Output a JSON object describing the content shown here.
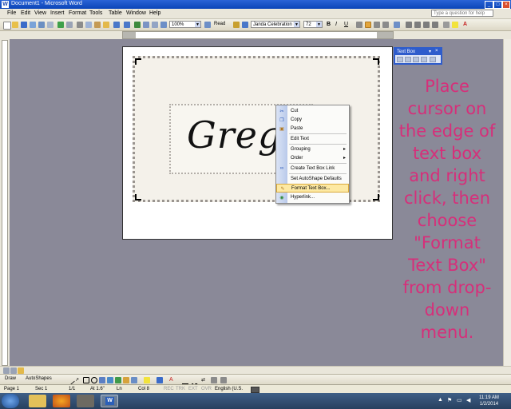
{
  "window": {
    "title": "Document1 - Microsoft Word"
  },
  "menu": [
    "File",
    "Edit",
    "View",
    "Insert",
    "Format",
    "Tools",
    "Table",
    "Window",
    "Help"
  ],
  "help_box": {
    "placeholder": "Type a question for help"
  },
  "toolbar": {
    "zoom": "100%",
    "read": "Read",
    "font": "Janda Celebration Scri",
    "size": "72"
  },
  "document": {
    "script_text": "Greg"
  },
  "context_menu": [
    {
      "label": "Cut",
      "icon": "scissors-icon"
    },
    {
      "label": "Copy",
      "icon": "copy-icon"
    },
    {
      "label": "Paste",
      "icon": "paste-icon"
    },
    {
      "label": "Edit Text",
      "icon": ""
    },
    {
      "label": "Grouping",
      "icon": "",
      "submenu": true
    },
    {
      "label": "Order",
      "icon": "",
      "submenu": true
    },
    {
      "label": "Create Text Box Link",
      "icon": "link-icon"
    },
    {
      "label": "Set AutoShape Defaults",
      "icon": ""
    },
    {
      "label": "Format Text Box...",
      "icon": "format-textbox-icon",
      "highlighted": true
    },
    {
      "label": "Hyperlink...",
      "icon": "hyperlink-icon"
    }
  ],
  "textbox_toolbar": {
    "title": "Text Box"
  },
  "instruction": "Place cursor on the edge of text box and right click, then choose \"Format Text Box\" from drop-down menu.",
  "drawing_toolbar": {
    "draw": "Draw",
    "autoshapes": "AutoShapes"
  },
  "status": {
    "page": "Page 1",
    "sec": "Sec 1",
    "pages": "1/1",
    "at": "At 1.6\"",
    "ln": "Ln",
    "col": "Col 8",
    "rec": "REC",
    "trk": "TRK",
    "ext": "EXT",
    "ovr": "OVR",
    "lang": "English (U.S."
  },
  "taskbar": {
    "time": "11:19 AM",
    "date": "1/2/2014"
  },
  "colors": {
    "instruction": "#d62f7a",
    "title_bar": "#0b45b8",
    "menu_highlight": "#fde9a3"
  }
}
